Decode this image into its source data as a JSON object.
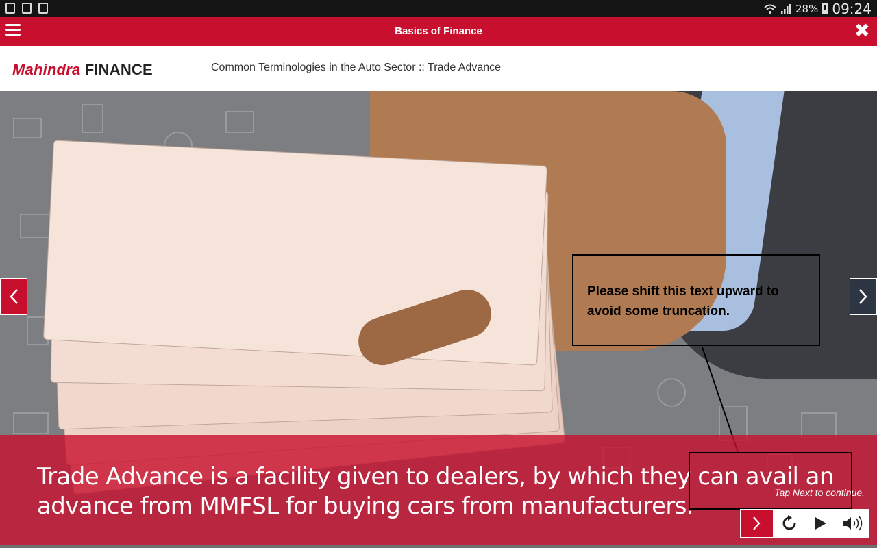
{
  "status_bar": {
    "left_icons": [
      "notification-icon",
      "sim-icon",
      "image-icon"
    ],
    "battery": "28%",
    "time": "09:24"
  },
  "header": {
    "title": "Basics of Finance",
    "menu_icon": "hamburger-menu-icon",
    "close_icon": "close-icon"
  },
  "brand": {
    "logo_part1": "Mahindra",
    "logo_part2": "FINANCE",
    "breadcrumb": "Common Terminologies in the Auto Sector :: Trade Advance"
  },
  "stage": {
    "review_note": "Please shift this text upward to avoid some truncation.",
    "caption": "Trade Advance is a facility given to dealers, by which they can avail an advance from MMFSL for buying cars from manufacturers.",
    "tap_next": "Tap Next to continue."
  },
  "controls": [
    "next-icon",
    "replay-icon",
    "play-icon",
    "volume-icon"
  ],
  "colors": {
    "brand_red": "#c8102e",
    "nav_dark": "#2e3644"
  }
}
